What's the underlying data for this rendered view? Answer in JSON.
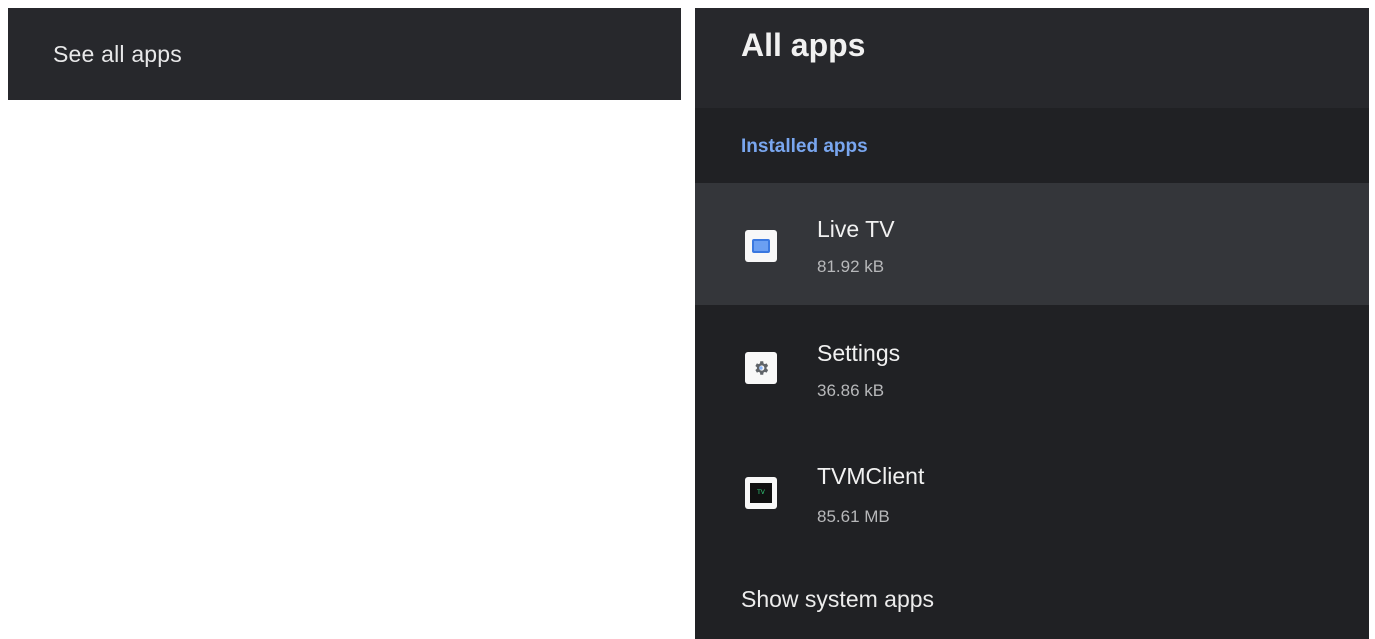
{
  "left_panel": {
    "see_all_apps_label": "See all apps"
  },
  "right_panel": {
    "title": "All apps",
    "section_header": "Installed apps",
    "apps": [
      {
        "name": "Live TV",
        "size": "81.92 kB",
        "icon": "live-tv-icon",
        "focused": true
      },
      {
        "name": "Settings",
        "size": "36.86 kB",
        "icon": "settings-gear-icon",
        "focused": false
      },
      {
        "name": "TVMClient",
        "size": "85.61 MB",
        "icon": "tvmclient-icon",
        "icon_text": "TV",
        "focused": false
      }
    ],
    "show_system_apps_label": "Show system apps"
  },
  "colors": {
    "panel_bg": "#202124",
    "header_bg": "#27282c",
    "focused_row_bg": "#34363a",
    "accent_blue": "#79a6ef",
    "text_primary": "#f1f1f1",
    "text_secondary": "#b7b8ba"
  }
}
